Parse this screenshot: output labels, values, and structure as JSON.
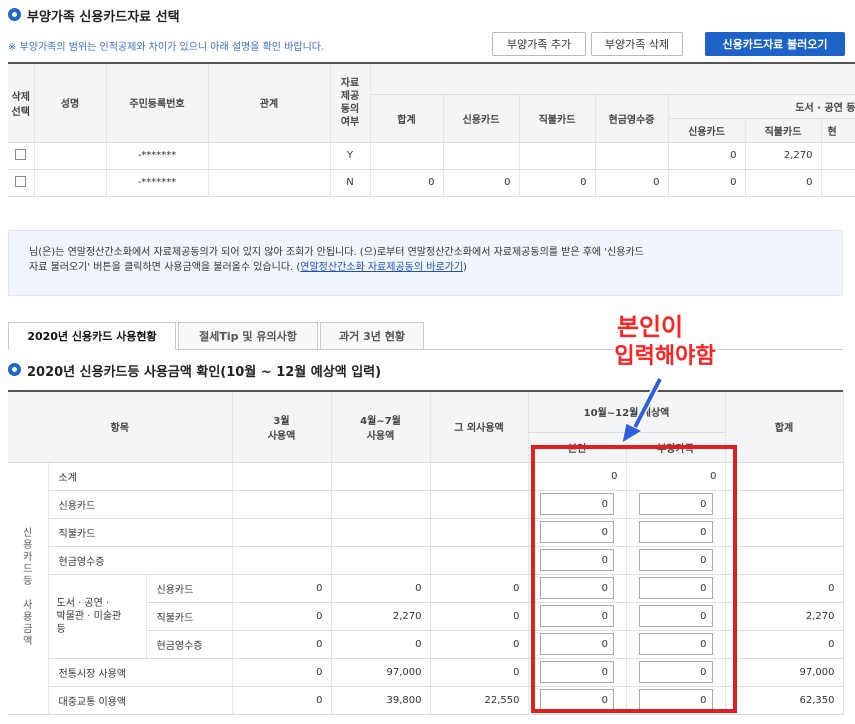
{
  "section1": {
    "title": "부양가족 신용카드자료 선택",
    "notice": "※ 부양가족의 범위는 인적공제와 차이가 있으니 아래 설명을 확인 바랍니다.",
    "btn_add": "부양가족 추가",
    "btn_delete": "부양가족 삭제",
    "btn_load": "신용카드자료 불러오기"
  },
  "dep_table": {
    "headers": {
      "delete_select": "삭제\n선택",
      "name": "성명",
      "rrn": "주민등록번호",
      "relation": "관계",
      "consent": "자료\n제공\n동의\n여부",
      "total": "합계",
      "credit": "신용카드",
      "debit": "직불카드",
      "cash": "현금영수증",
      "books_group": "도서 · 공연 등",
      "books_credit": "신용카드",
      "books_debit": "직불카드",
      "books_cash": "현"
    },
    "rows": [
      {
        "rrn": "-*******",
        "consent": "Y",
        "total": "",
        "credit": "",
        "debit": "",
        "cash": "",
        "b_credit": "0",
        "b_debit": "2,270"
      },
      {
        "rrn": "-*******",
        "consent": "N",
        "total": "0",
        "credit": "0",
        "debit": "0",
        "cash": "0",
        "b_credit": "0",
        "b_debit": "0"
      }
    ]
  },
  "info": {
    "line1": "님(은)는 연말정산간소화에서 자료제공동의가 되어 있지 않아 조회가 안됩니다.          (으)로부터 연말정산간소화에서 자료제공동의를 받은 후에 '신용카드",
    "line2": "자료 불러오기' 버튼을 클릭하면 사용금액을 불러올수 있습니다. (",
    "link": "연말정산간소화 자료제공동의 바로가기",
    "line2_end": ")"
  },
  "tabs": [
    "2020년 신용카드 사용현황",
    "절세Tip 및 유의사항",
    "과거 3년 현황"
  ],
  "section2": {
    "title": "2020년 신용카드등 사용금액 확인(10월 ~ 12월 예상액 입력)"
  },
  "usage_table": {
    "headers": {
      "item": "항목",
      "march": "3월\n사용액",
      "apr_jul": "4월~7월\n사용액",
      "other": "그 외사용액",
      "oct_dec": "10월~12월 예상액",
      "self": "본인",
      "dependent": "부양가족",
      "total": "합계"
    },
    "side_label": "신\n용\n카\n드\n등\n \n사\n용\n금\n액",
    "books_label": "도서 · 공연 ·\n박물관 · 미술관\n등",
    "rows": [
      {
        "label": "소계",
        "march": "",
        "aprjul": "",
        "other": "",
        "self": "0",
        "dep": "0",
        "total": "",
        "input": false
      },
      {
        "label": "신용카드",
        "march": "",
        "aprjul": "",
        "other": "",
        "self": "0",
        "dep": "0",
        "total": "",
        "input": true
      },
      {
        "label": "직불카드",
        "march": "",
        "aprjul": "",
        "other": "",
        "self": "0",
        "dep": "0",
        "total": "",
        "input": true
      },
      {
        "label": "현금영수증",
        "march": "",
        "aprjul": "",
        "other": "",
        "self": "0",
        "dep": "0",
        "total": "",
        "input": true
      },
      {
        "label": "신용카드",
        "march": "0",
        "aprjul": "0",
        "other": "0",
        "self": "0",
        "dep": "0",
        "total": "0",
        "input": true
      },
      {
        "label": "직불카드",
        "march": "0",
        "aprjul": "2,270",
        "other": "0",
        "self": "0",
        "dep": "0",
        "total": "2,270",
        "input": true
      },
      {
        "label": "현금영수증",
        "march": "0",
        "aprjul": "0",
        "other": "0",
        "self": "0",
        "dep": "0",
        "total": "0",
        "input": true
      },
      {
        "label": "전통시장 사용액",
        "march": "0",
        "aprjul": "97,000",
        "other": "0",
        "self": "0",
        "dep": "0",
        "total": "97,000",
        "input": true
      },
      {
        "label": "대중교통 이용액",
        "march": "0",
        "aprjul": "39,800",
        "other": "22,550",
        "self": "0",
        "dep": "0",
        "total": "62,350",
        "input": true
      }
    ]
  },
  "annotation": {
    "line1": "본인이",
    "line2": "입력해야함",
    "color": "#e02020"
  }
}
